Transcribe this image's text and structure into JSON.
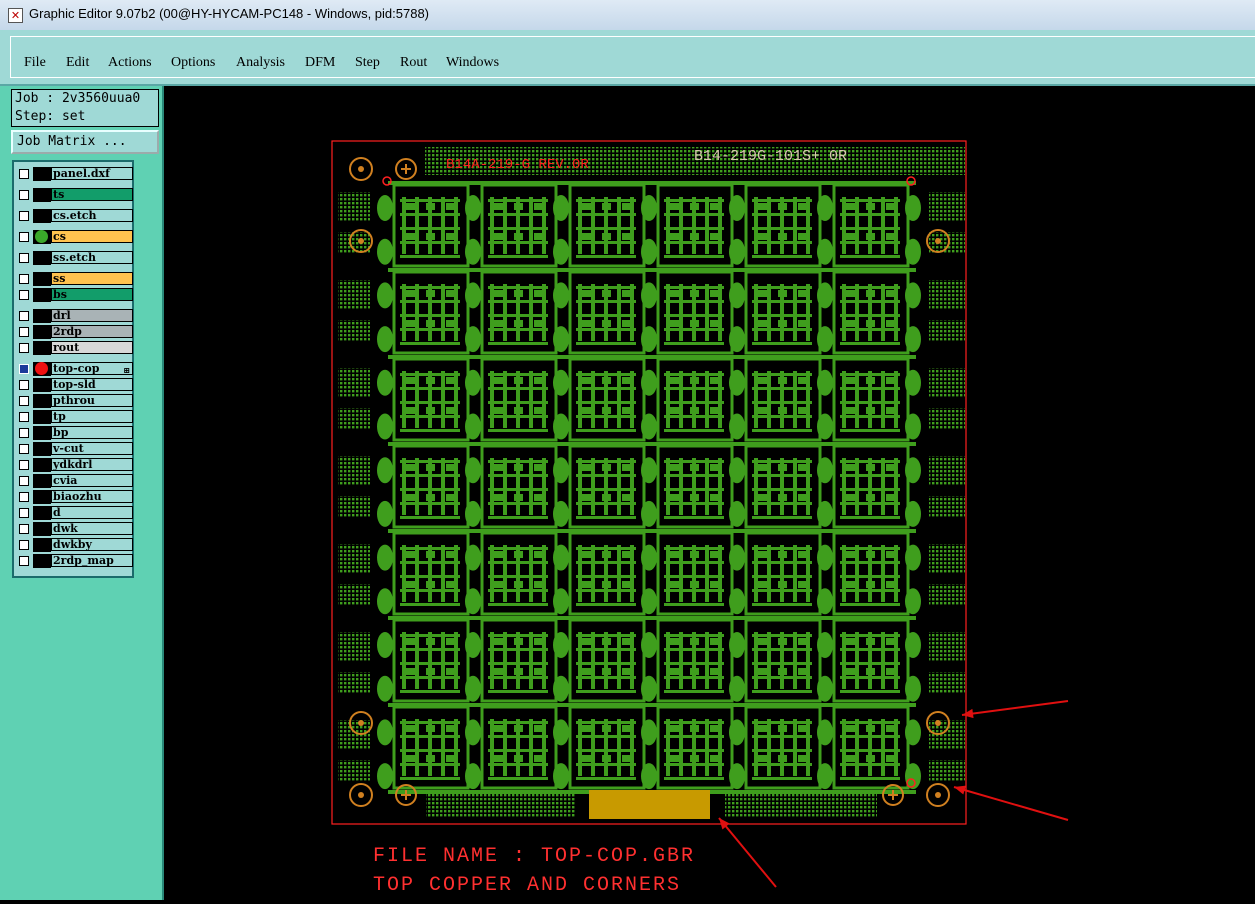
{
  "window": {
    "title": "Graphic Editor 9.07b2 (00@HY-HYCAM-PC148 - Windows, pid:5788)"
  },
  "menu": [
    {
      "label": "File"
    },
    {
      "label": "Edit"
    },
    {
      "label": "Actions"
    },
    {
      "label": "Options"
    },
    {
      "label": "Analysis"
    },
    {
      "label": "DFM"
    },
    {
      "label": "Step"
    },
    {
      "label": "Rout"
    },
    {
      "label": "Windows"
    }
  ],
  "job": {
    "job_label": "Job : 2v3560uua0",
    "step_label": "Step: set",
    "matrix_button": "Job Matrix ..."
  },
  "layers": [
    {
      "name": "panel.dxf",
      "color": "#9fd9d6",
      "dot": ""
    },
    {
      "name": "ts",
      "color": "#129d6a",
      "dot": ""
    },
    {
      "name": "cs.etch",
      "color": "#9fd9d6",
      "dot": ""
    },
    {
      "name": "cs",
      "color": "#ffc34f",
      "dot": "#3aa82a"
    },
    {
      "name": "ss.etch",
      "color": "#9fd9d6",
      "dot": ""
    },
    {
      "name": "ss",
      "color": "#ffc34f",
      "dot": ""
    },
    {
      "name": "bs",
      "color": "#129d6a",
      "dot": ""
    },
    {
      "name": "drl",
      "color": "#a9b3b6",
      "dot": ""
    },
    {
      "name": "2rdp",
      "color": "#a9b3b6",
      "dot": ""
    },
    {
      "name": "rout",
      "color": "#d8d8d8",
      "dot": ""
    },
    {
      "name": "top-cop",
      "color": "#9fd9d6",
      "dot": "#ee1111"
    },
    {
      "name": "top-sld",
      "color": "#9fd9d6",
      "dot": ""
    },
    {
      "name": "pthrou",
      "color": "#9fd9d6",
      "dot": ""
    },
    {
      "name": "tp",
      "color": "#9fd9d6",
      "dot": ""
    },
    {
      "name": "bp",
      "color": "#9fd9d6",
      "dot": ""
    },
    {
      "name": "v-cut",
      "color": "#9fd9d6",
      "dot": ""
    },
    {
      "name": "ydkdrl",
      "color": "#9fd9d6",
      "dot": ""
    },
    {
      "name": "cvia",
      "color": "#9fd9d6",
      "dot": ""
    },
    {
      "name": "biaozhu",
      "color": "#9fd9d6",
      "dot": ""
    },
    {
      "name": "d",
      "color": "#9fd9d6",
      "dot": ""
    },
    {
      "name": "dwk",
      "color": "#9fd9d6",
      "dot": ""
    },
    {
      "name": "dwkby",
      "color": "#9fd9d6",
      "dot": ""
    },
    {
      "name": "2rdp_map",
      "color": "#9fd9d6",
      "dot": ""
    }
  ],
  "board": {
    "label_left": "B14A-219-G REV.0R",
    "label_right": "B14-219G-101S+ 0R",
    "copper_color": "#3f9e1d",
    "outline_color": "#ff2020",
    "fiducial_color": "#d08020",
    "block_color": "#c89a00"
  },
  "annotation": {
    "line1": "FILE NAME : TOP-COP.GBR",
    "line2": "TOP COPPER AND CORNERS"
  }
}
